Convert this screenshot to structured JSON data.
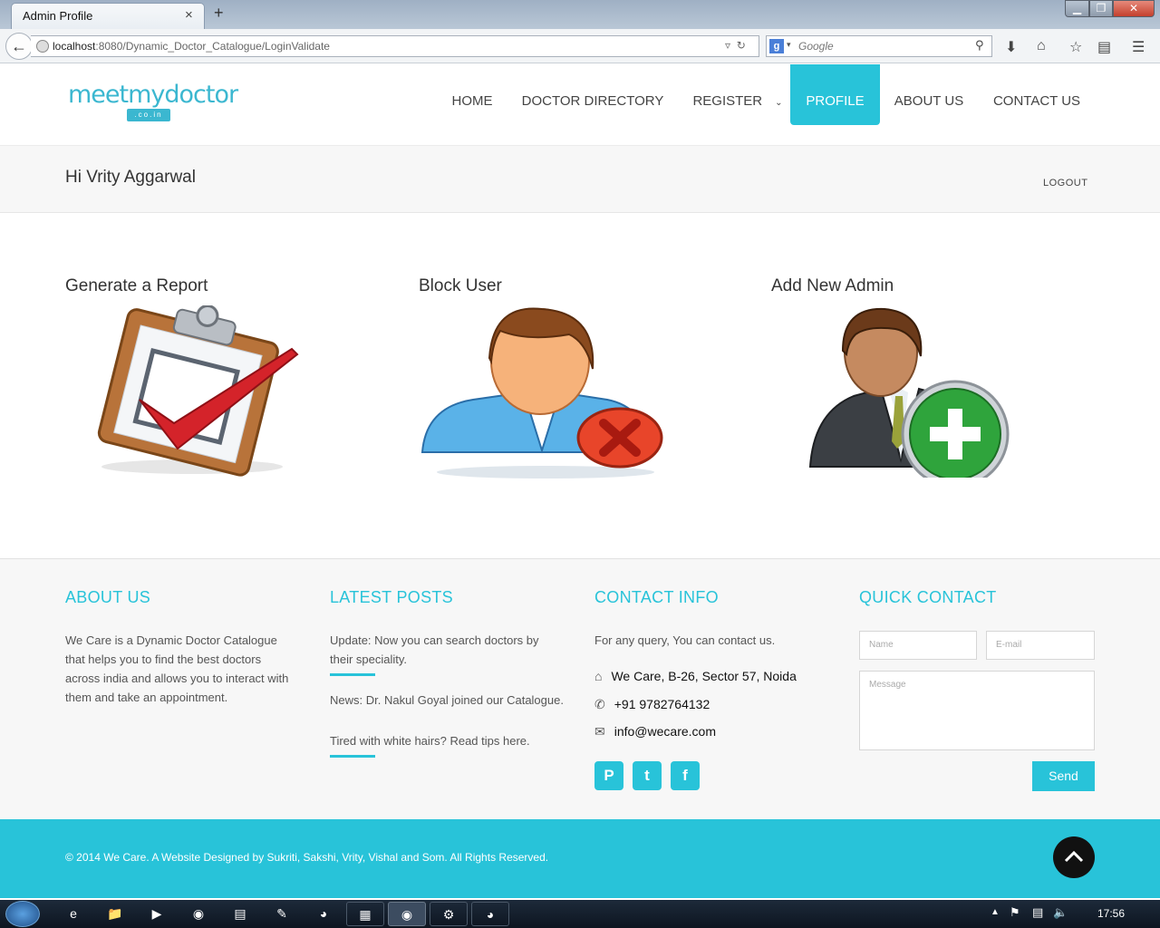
{
  "browser": {
    "tab_title": "Admin Profile",
    "tab_close": "×",
    "new_tab": "+",
    "url_host": "localhost",
    "url_rest": ":8080/Dynamic_Doctor_Catalogue/LoginValidate",
    "search_placeholder": "Google",
    "win_min": "▁",
    "win_max": "❐",
    "win_close": "✕"
  },
  "logo": {
    "text": "meetmydoctor",
    "sub": ".co.in"
  },
  "nav": {
    "items": [
      "HOME",
      "DOCTOR DIRECTORY",
      "REGISTER",
      "PROFILE",
      "ABOUT US",
      "CONTACT US"
    ],
    "active": "PROFILE",
    "active_color": "#28c3d9"
  },
  "greeting": "Hi Vrity Aggarwal",
  "logout": "LOGOUT",
  "cards": [
    {
      "title": "Generate a Report",
      "icon": "clipboard-check-icon"
    },
    {
      "title": "Block User",
      "icon": "block-user-icon"
    },
    {
      "title": "Add New Admin",
      "icon": "add-admin-icon"
    }
  ],
  "footer": {
    "about": {
      "heading": "ABOUT US",
      "lines": [
        "We Care is a Dynamic Doctor Catalogue",
        "that helps you to find the best doctors",
        "across india and allows you to interact with",
        "them and take an appointment."
      ]
    },
    "posts": {
      "heading": "LATEST POSTS",
      "items": [
        [
          "Update: Now you can search doctors by",
          "their speciality."
        ],
        [
          "News: Dr. Nakul Goyal joined our Catalogue."
        ],
        [
          "Tired with white hairs? Read tips here."
        ]
      ]
    },
    "contact": {
      "heading": "CONTACT INFO",
      "intro": "For any query, You can contact us.",
      "address": "We Care, B-26, Sector 57, Noida",
      "phone": "+91 9782764132",
      "email": "info@wecare.com"
    },
    "quick": {
      "heading": "QUICK CONTACT",
      "name_ph": "Name",
      "email_ph": "E-mail",
      "message_ph": "Message",
      "send": "Send"
    },
    "copyright": "© 2014 We Care. A Website Designed by Sukriti, Sakshi, Vrity, Vishal and Som. All Rights Reserved."
  },
  "taskbar": {
    "clock": "17:56"
  },
  "colors": {
    "accent": "#28c3d9"
  }
}
